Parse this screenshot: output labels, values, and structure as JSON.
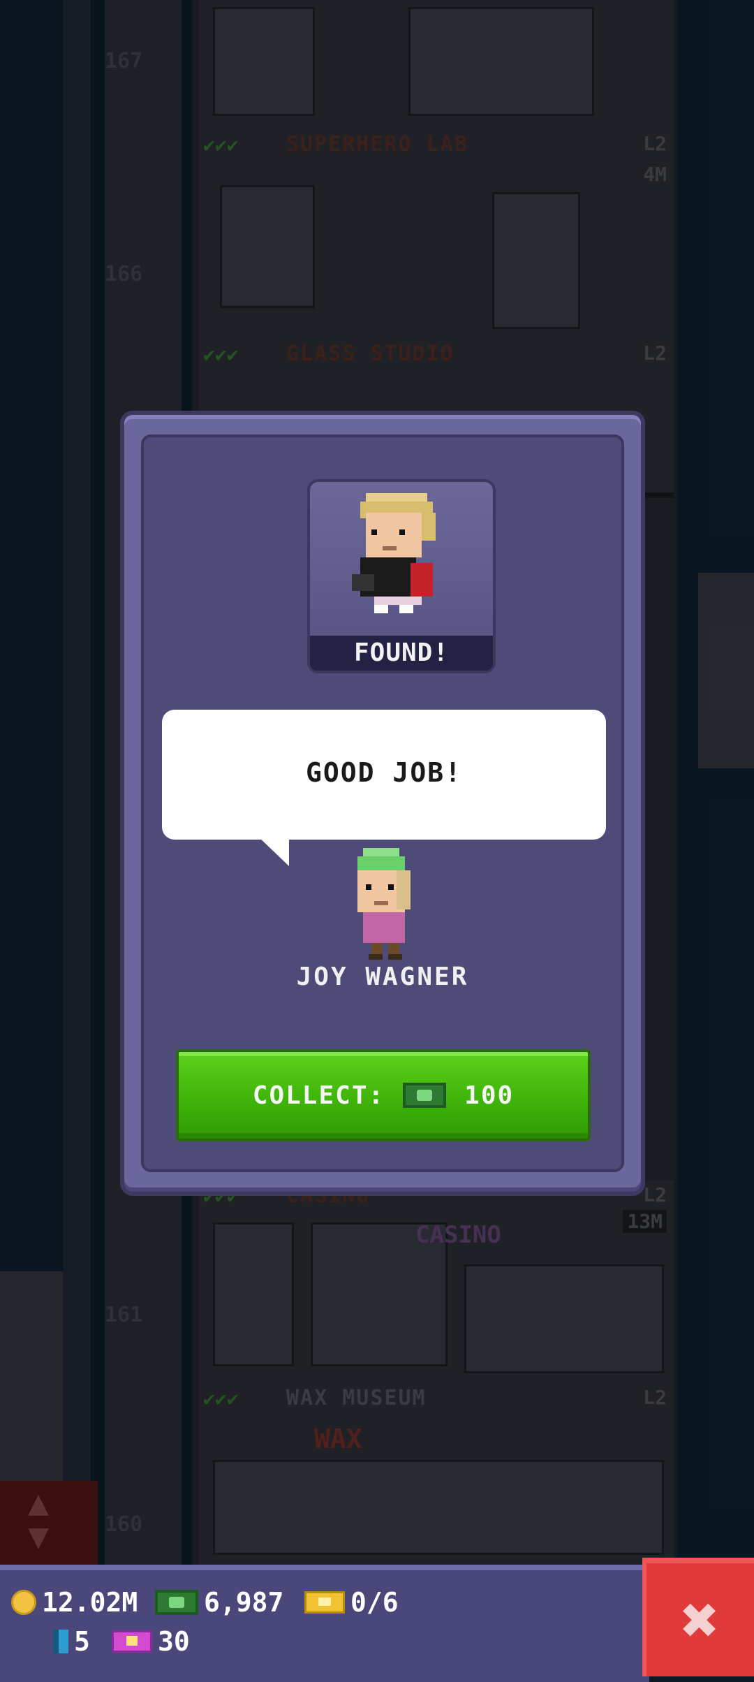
{
  "background": {
    "floors": [
      {
        "title": "SUPERHERO LAB",
        "level": "L2",
        "number": "167",
        "income": "4M"
      },
      {
        "title": "GLASS STUDIO",
        "level": "L2",
        "number": "166",
        "income": ""
      },
      {
        "title": "CASINO",
        "level": "L2",
        "number": "161",
        "income": "13M"
      },
      {
        "title": "WAX MUSEUM",
        "level": "L2",
        "number": "160",
        "income": ""
      }
    ],
    "signs": {
      "casino": "CASINO",
      "wax": "WAX"
    }
  },
  "popup": {
    "found_label": "FOUND!",
    "speech": "GOOD JOB!",
    "npc_name": "JOY WAGNER",
    "collect_label": "COLLECT:",
    "collect_amount": "100"
  },
  "hud": {
    "coins": "12.02M",
    "bux": "6,987",
    "gold_tickets": "0/6",
    "elevator_chips": "5",
    "tbux": "30"
  },
  "icons": {
    "coin": "coin-icon",
    "bux": "bux-icon",
    "gold_ticket": "gold-ticket-icon",
    "elevator": "elevator-icon",
    "tbux": "tower-bux-icon",
    "close": "close-icon"
  },
  "colors": {
    "collect_green": "#46b90c",
    "close_red": "#e03a3a",
    "popup_purple": "#6a679c",
    "hud_purple": "#4a477a"
  }
}
